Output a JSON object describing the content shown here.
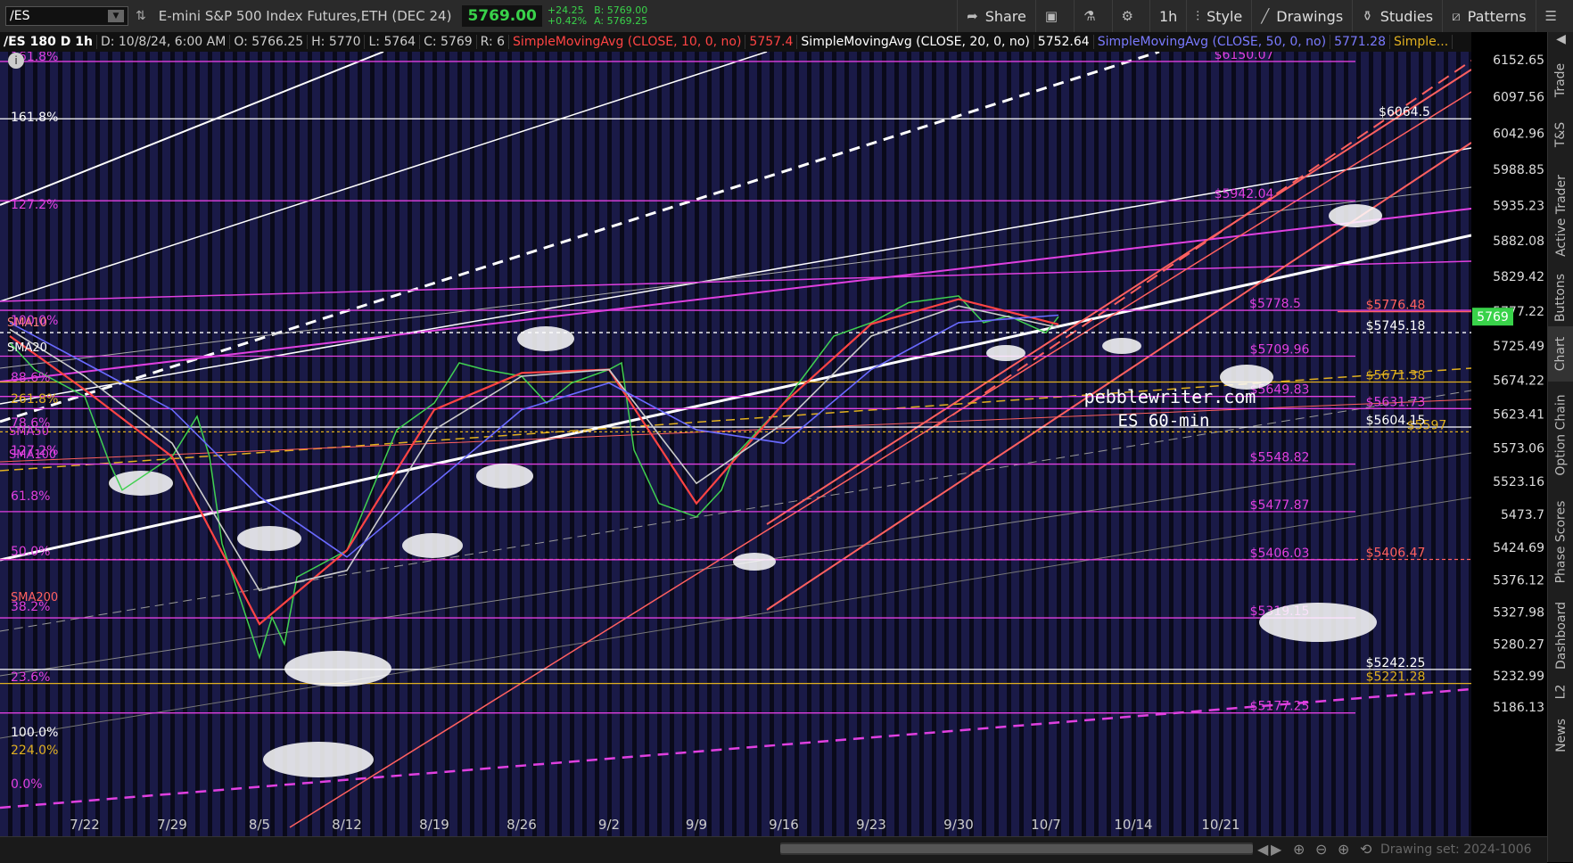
{
  "toolbar": {
    "symbol": "/ES",
    "description": "E-mini S&P 500 Index Futures,ETH (DEC 24)",
    "last_price": "5769.00",
    "change": "+24.25",
    "change_pct": "+0.42%",
    "bid": "B: 5769.00",
    "ask": "A: 5769.25",
    "share_label": "Share",
    "timeframe_label": "1h",
    "style_label": "Style",
    "drawings_label": "Drawings",
    "studies_label": "Studies",
    "patterns_label": "Patterns"
  },
  "study_bar": {
    "chart_label": "/ES 180 D 1h",
    "date": "D: 10/8/24, 6:00 AM",
    "open": "O: 5766.25",
    "high": "H: 5770",
    "low": "L: 5764",
    "close": "C: 5769",
    "range": "R: 6",
    "sma10_label": "SimpleMovingAvg (CLOSE, 10, 0, no)",
    "sma10_value": "5757.4",
    "sma20_label": "SimpleMovingAvg (CLOSE, 20, 0, no)",
    "sma20_value": "5752.64",
    "sma50_label": "SimpleMovingAvg (CLOSE, 50, 0, no)",
    "sma50_value": "5771.28",
    "more_label": "Simple..."
  },
  "sidebar_tabs": [
    "Trade",
    "T&S",
    "Active Trader",
    "Buttons",
    "Chart",
    "Option Chain",
    "Phase Scores",
    "Dashboard",
    "L2",
    "News"
  ],
  "bottom": {
    "drawing_set": "Drawing set: 2024-1006"
  },
  "colors": {
    "background": "#0a0a1a",
    "column_band": "#1b1b4a",
    "price_green": "#39d24a",
    "sma10": "#ff4444",
    "sma20": "#cccccc",
    "sma50": "#6a6aff",
    "fib_magenta": "#e040e0",
    "gold": "#e0b020",
    "salmon": "#ff6060"
  },
  "chart_data": {
    "type": "line",
    "title": "ES 60-min",
    "watermark": "pebblewriter.com",
    "x_tick_labels": [
      "7/22",
      "7/29",
      "8/5",
      "8/12",
      "8/19",
      "8/26",
      "9/2",
      "9/9",
      "9/16",
      "9/23",
      "9/30",
      "10/7",
      "10/14",
      "10/21"
    ],
    "price_axis_labels": [
      "6152.65",
      "6097.56",
      "6042.96",
      "5988.85",
      "5935.23",
      "5882.08",
      "5829.42",
      "5777.22",
      "5725.49",
      "5674.22",
      "5623.41",
      "5573.06",
      "5523.16",
      "5473.7",
      "5424.69",
      "5376.12",
      "5327.98",
      "5280.27",
      "5232.99",
      "5186.13"
    ],
    "ylim": [
      5186.13,
      6152.65
    ],
    "current_price_tag": "5769",
    "series": [
      {
        "name": "ES 1h",
        "x": [
          "7/16",
          "7/18",
          "7/22",
          "7/24",
          "7/25",
          "7/29",
          "7/31",
          "8/1",
          "8/2",
          "8/5",
          "8/6",
          "8/7",
          "8/8",
          "8/9",
          "8/12",
          "8/14",
          "8/16",
          "8/19",
          "8/21",
          "8/23",
          "8/26",
          "8/28",
          "8/30",
          "9/2",
          "9/3",
          "9/4",
          "9/6",
          "9/9",
          "9/11",
          "9/12",
          "9/16",
          "9/18",
          "9/20",
          "9/23",
          "9/26",
          "9/30",
          "10/2",
          "10/4",
          "10/7",
          "10/8"
        ],
        "values": [
          5730,
          5690,
          5650,
          5550,
          5510,
          5560,
          5620,
          5560,
          5430,
          5260,
          5320,
          5280,
          5380,
          5390,
          5420,
          5510,
          5600,
          5640,
          5700,
          5690,
          5680,
          5640,
          5670,
          5690,
          5700,
          5570,
          5490,
          5470,
          5510,
          5560,
          5640,
          5690,
          5740,
          5760,
          5790,
          5800,
          5760,
          5770,
          5745,
          5769
        ]
      },
      {
        "name": "SimpleMovingAvg (CLOSE, 10, 0, no)",
        "x": [
          "7/16",
          "7/22",
          "7/29",
          "8/5",
          "8/12",
          "8/19",
          "8/26",
          "9/2",
          "9/9",
          "9/16",
          "9/23",
          "9/30",
          "10/8"
        ],
        "values": [
          5740,
          5660,
          5560,
          5310,
          5420,
          5630,
          5685,
          5690,
          5490,
          5640,
          5758,
          5795,
          5757.4
        ]
      },
      {
        "name": "SimpleMovingAvg (CLOSE, 20, 0, no)",
        "x": [
          "7/16",
          "7/22",
          "7/29",
          "8/5",
          "8/12",
          "8/19",
          "8/26",
          "9/2",
          "9/9",
          "9/16",
          "9/23",
          "9/30",
          "10/8"
        ],
        "values": [
          5750,
          5680,
          5580,
          5360,
          5390,
          5600,
          5680,
          5690,
          5520,
          5610,
          5740,
          5785,
          5752.64
        ]
      },
      {
        "name": "SimpleMovingAvg (CLOSE, 50, 0, no)",
        "x": [
          "7/16",
          "7/22",
          "7/29",
          "8/5",
          "8/12",
          "8/19",
          "8/26",
          "9/2",
          "9/9",
          "9/16",
          "9/23",
          "9/30",
          "10/8"
        ],
        "values": [
          5760,
          5700,
          5630,
          5500,
          5410,
          5520,
          5630,
          5670,
          5600,
          5580,
          5690,
          5760,
          5771.28
        ]
      }
    ],
    "horizontal_levels": [
      {
        "label": "$6150.07",
        "value": 6150.07
      },
      {
        "label": "$6064.5",
        "value": 6064.5
      },
      {
        "label": "$5942.04",
        "value": 5942.04
      },
      {
        "label": "$5778.5",
        "value": 5778.5
      },
      {
        "label": "$5776.48",
        "value": 5776.48
      },
      {
        "label": "$5745.18",
        "value": 5745.18
      },
      {
        "label": "$5709.96",
        "value": 5709.96
      },
      {
        "label": "$5671.38",
        "value": 5671.38
      },
      {
        "label": "$5649.83",
        "value": 5649.83
      },
      {
        "label": "$5631.73",
        "value": 5631.73
      },
      {
        "label": "$5604.15",
        "value": 5604.15
      },
      {
        "label": "$5597",
        "value": 5597
      },
      {
        "label": "$5548.82",
        "value": 5548.82
      },
      {
        "label": "$5477.87",
        "value": 5477.87
      },
      {
        "label": "$5406.47",
        "value": 5406.47
      },
      {
        "label": "$5406.03",
        "value": 5406.03
      },
      {
        "label": "$5319.15",
        "value": 5319.15
      },
      {
        "label": "$5242.25",
        "value": 5242.25
      },
      {
        "label": "$5221.28",
        "value": 5221.28
      },
      {
        "label": "$5177.25",
        "value": 5177.25
      }
    ],
    "fib_labels": [
      "161.8%",
      "161.8%",
      "127.2%",
      "100.0%",
      "88.6%",
      "261.8%",
      "78.6%",
      "127.2%",
      "61.8%",
      "50.0%",
      "38.2%",
      "23.6%",
      "100.0%",
      "224.0%",
      "0.0%"
    ],
    "ma_labels": [
      "SMA10",
      "SMA20",
      "SMA50",
      "SMA100",
      "SMA200"
    ]
  }
}
